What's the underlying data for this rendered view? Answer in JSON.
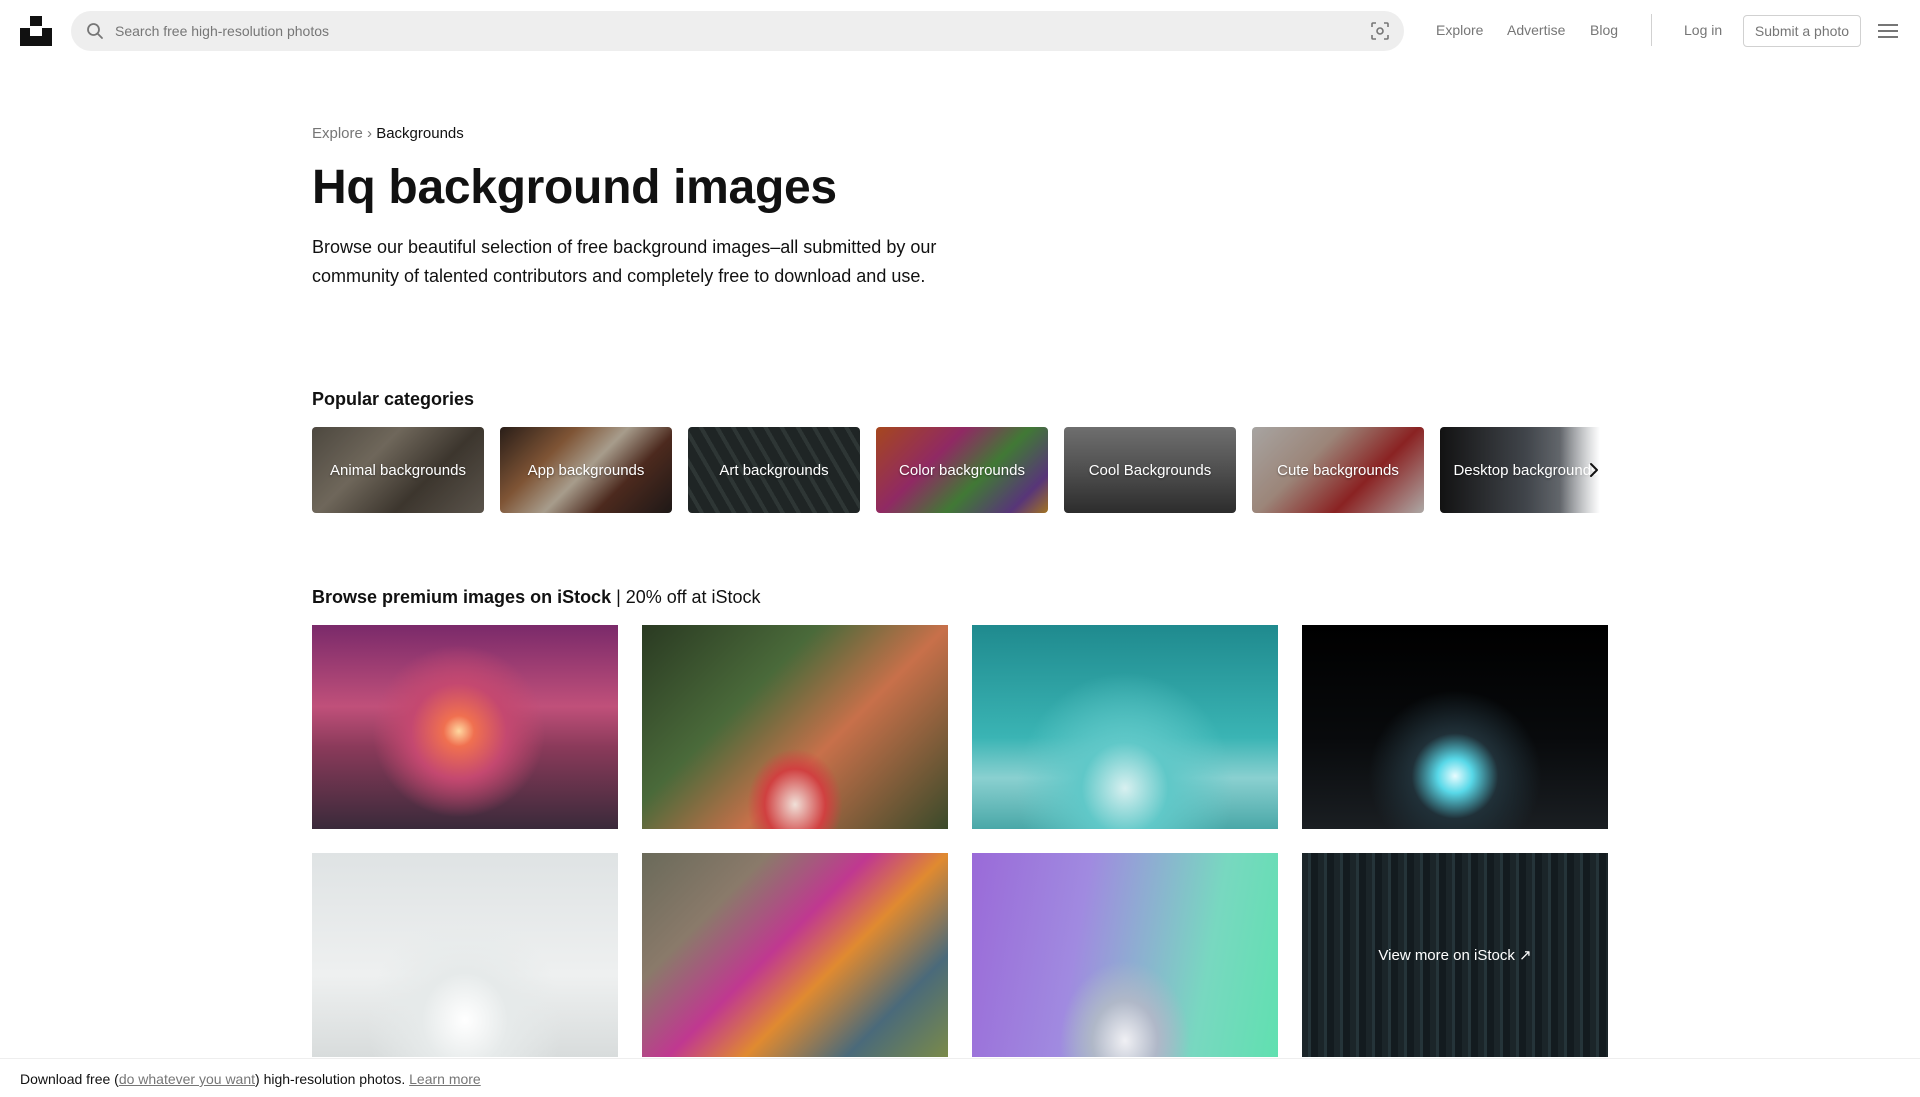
{
  "header": {
    "search_placeholder": "Search free high-resolution photos",
    "nav": [
      "Explore",
      "Advertise",
      "Blog"
    ],
    "login": "Log in",
    "submit": "Submit a photo"
  },
  "breadcrumb": {
    "parent": "Explore",
    "separator": "›",
    "current": "Backgrounds"
  },
  "hero": {
    "title": "Hq background images",
    "description": "Browse our beautiful selection of free background images–all submitted by our community of talented contributors and completely free to download and use."
  },
  "categories": {
    "title": "Popular categories",
    "items": [
      "Animal backgrounds",
      "App backgrounds",
      "Art backgrounds",
      "Color backgrounds",
      "Cool Backgrounds",
      "Cute backgrounds",
      "Desktop backgrounds"
    ]
  },
  "istock": {
    "title_bold": "Browse premium images on iStock",
    "title_rest": " | 20% off at iStock",
    "view_more": "View more on iStock ↗"
  },
  "banner": {
    "prefix": "Download free (",
    "link": "do whatever you want",
    "middle": ") high-resolution photos. ",
    "learn_more": "Learn more"
  },
  "colors": {
    "accent_text": "#111111",
    "muted_text": "#767676",
    "search_bg": "#eeeeee"
  }
}
